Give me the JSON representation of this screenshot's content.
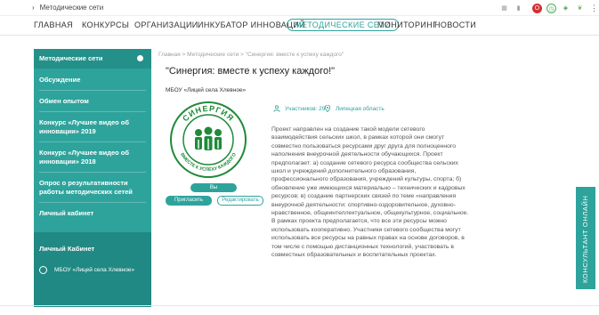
{
  "browser": {
    "breadcrumb": "Методические сети",
    "extensions": [
      {
        "name": "grid-icon",
        "color": "#9e9e9e",
        "glyph": "▦"
      },
      {
        "name": "bookmark-icon",
        "color": "#9e9e9e",
        "glyph": "▮"
      },
      {
        "name": "opera-icon",
        "color": "#d32f2f",
        "glyph": "O"
      },
      {
        "name": "clock-icon",
        "color": "#4caf50",
        "glyph": "◷"
      },
      {
        "name": "shield-icon",
        "color": "#43a047",
        "glyph": "◈"
      },
      {
        "name": "leaf-icon",
        "color": "#7cb342",
        "glyph": "❦"
      }
    ]
  },
  "nav": {
    "items": [
      {
        "label": "ГЛАВНАЯ",
        "active": false
      },
      {
        "label": "КОНКУРСЫ",
        "active": false
      },
      {
        "label": "ОРГАНИЗАЦИИ",
        "active": false
      },
      {
        "label": "ИНКУБАТОР ИННОВАЦИЙ",
        "active": false
      },
      {
        "label": "МЕТОДИЧЕСКИЕ СЕТИ",
        "active": true
      },
      {
        "label": "МОНИТОРИНГ",
        "active": false
      },
      {
        "label": "НОВОСТИ",
        "active": false
      }
    ]
  },
  "sidebar": {
    "items": [
      {
        "label": "Методические сети"
      },
      {
        "label": "Обсуждение"
      },
      {
        "label": "Обмен опытом"
      },
      {
        "label": "Конкурс «Лучшее видео об инновации» 2019"
      },
      {
        "label": "Конкурс «Лучшее видео об инновации» 2018"
      },
      {
        "label": "Опрос о результативности работы методических сетей"
      },
      {
        "label": "Личный кабинет"
      }
    ],
    "cabinet": {
      "title": "Личный Кабинет",
      "user": "МБОУ «Лицей села Хлевное»"
    }
  },
  "main": {
    "breadcrumb": "Главная  >  Методические сети  >  \"Синергия: вместе к успеху каждого\"",
    "title": "\"Синергия: вместе к успеху каждого!\"",
    "org": "МБОУ «Лицей села Хлевное»",
    "participants": "Участников: 29",
    "region": "Липецкая область",
    "logo_top": "СИНЕРГИЯ",
    "logo_bottom": "ВМЕСТЕ К УСПЕХУ КАЖДОГО",
    "subscribed_label": "Вы присоединились",
    "invite_label": "Пригласить",
    "edit_label": "Редактировать",
    "description": "Проект направлен на создание такой модели сетевого взаимодействия сельских школ, в рамках которой они смогут совместно пользоваться ресурсами друг друга для полноценного наполнения внеурочной деятельности обучающихся. Проект предполагает: а) создание сетевого ресурса сообщества сельских школ и учреждений дополнительного образования, профессионального образования, учреждений культуры, спорта; б) обновление уже имеющихся материально – технических и кадровых ресурсов; в) создание партнерских связей по теме «направления внеурочной деятельности: спортивно-оздоровительное, духовно-нравственное, общеинтеллектуальное, общекультурное, социальное. В рамках проекта предполагается, что все эти ресурсы можно использовать кооперативно. Участники сетевого сообщества могут использовать все ресурсы на равных правах на основе договоров, в том числе с помощью дистанционных технологий, участвовать в совместных образовательных и воспитательных проектах."
  },
  "side_tab": {
    "label": "КОНСУЛЬТАНТ ОНЛАЙН"
  },
  "colors": {
    "accent": "#2ea39c",
    "logo_green": "#1f8a3a"
  }
}
